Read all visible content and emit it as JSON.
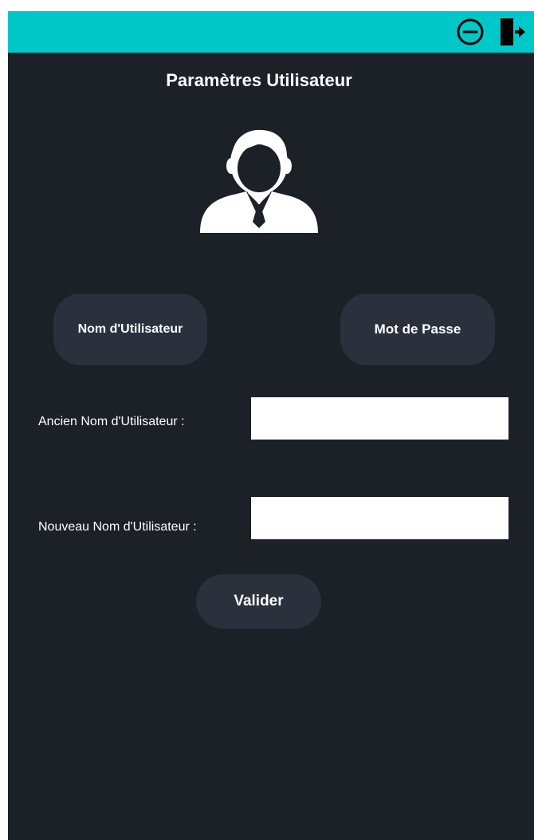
{
  "titlebar": {
    "icons": [
      "minimize-icon",
      "exit-door-icon"
    ],
    "color": "#00c8c8"
  },
  "page": {
    "title": "Paramètres Utilisateur",
    "background": "#1c2027"
  },
  "avatar": {
    "icon": "user-avatar-icon"
  },
  "tabs": {
    "username_label": "Nom d'Utilisateur",
    "password_label": "Mot de Passe"
  },
  "form": {
    "old_username_label": "Ancien Nom d'Utilisateur :",
    "old_username_value": "",
    "new_username_label": "Nouveau Nom d'Utilisateur :",
    "new_username_value": ""
  },
  "actions": {
    "validate_label": "Valider"
  }
}
